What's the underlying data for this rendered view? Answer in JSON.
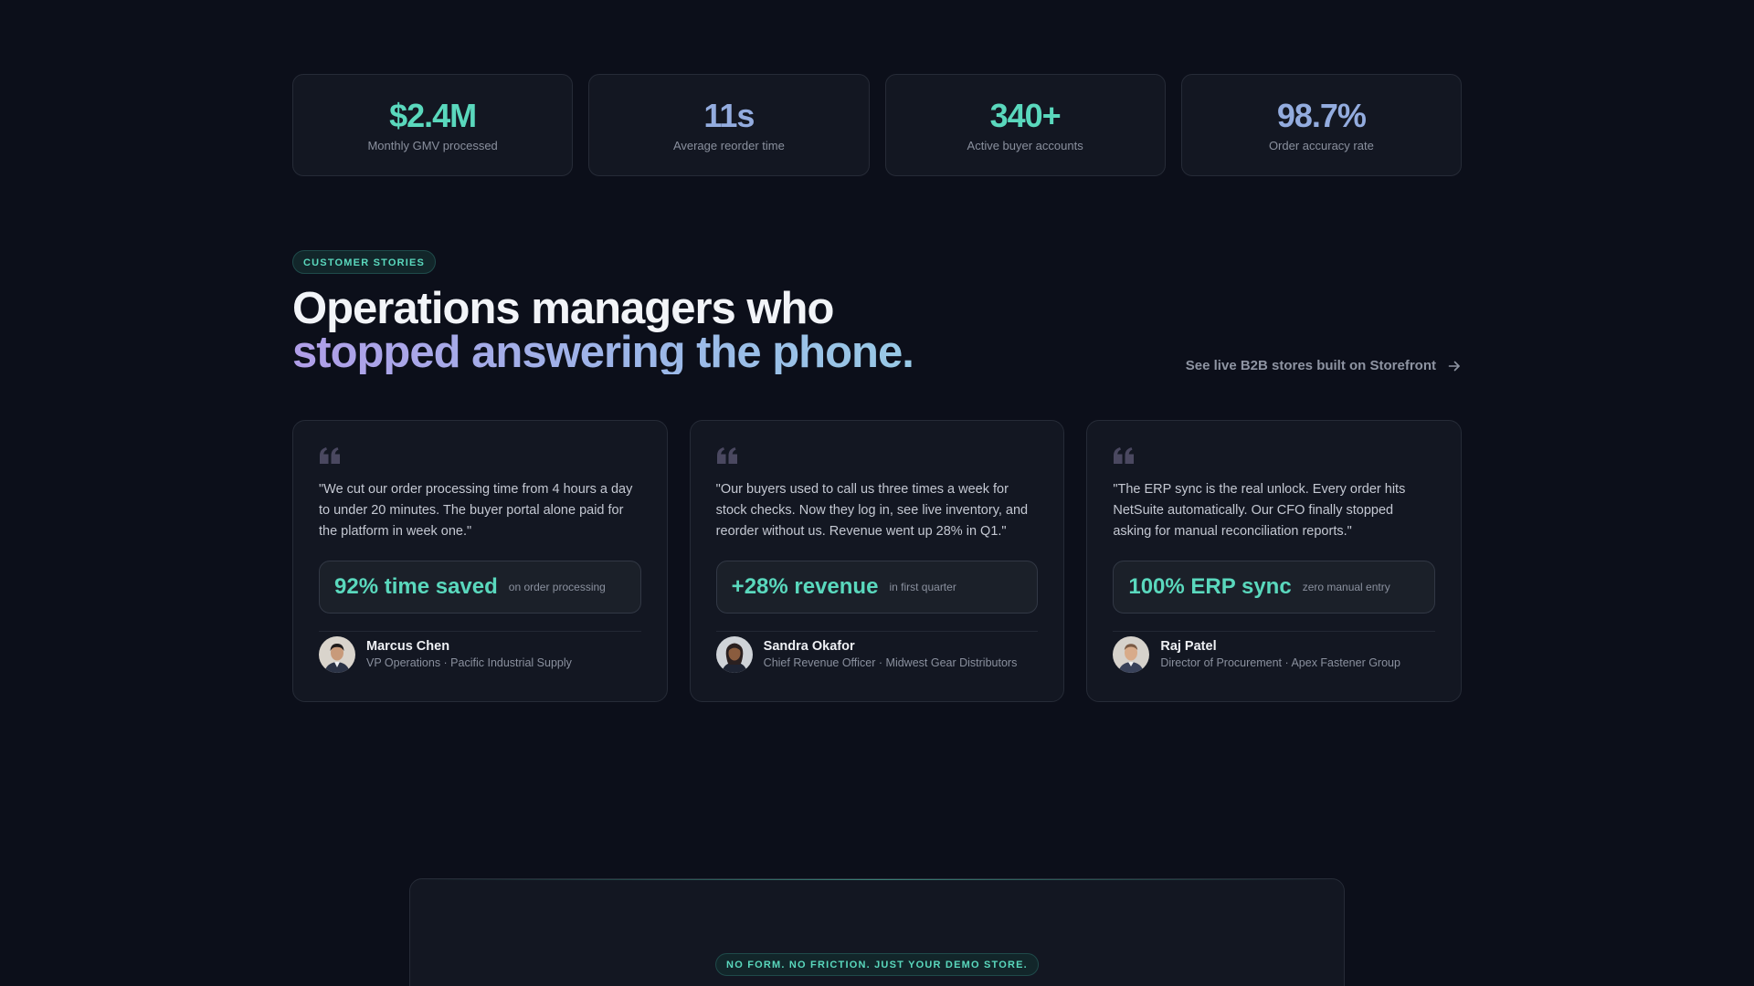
{
  "stats": [
    {
      "value": "$2.4M",
      "label": "Monthly GMV processed",
      "color": "#5ad8bd"
    },
    {
      "value": "11s",
      "label": "Average reorder time",
      "color": "#93acdf"
    },
    {
      "value": "340+",
      "label": "Active buyer accounts",
      "color": "#5ad8bd"
    },
    {
      "value": "98.7%",
      "label": "Order accuracy rate",
      "color": "#93acdf"
    }
  ],
  "section": {
    "badge": "CUSTOMER STORIES",
    "heading_line1": "Operations managers who",
    "heading_line2": "stopped answering the phone.",
    "link_label": "See live B2B stores built on Storefront",
    "link_icon": "arrow-right-icon"
  },
  "testimonials": [
    {
      "quote": "\"We cut our order processing time from 4 hours a day to under 20 minutes. The buyer portal alone paid for the platform in week one.\"",
      "metric_value": "92% time saved",
      "metric_note": "on order processing",
      "name": "Marcus Chen",
      "role": "VP Operations · Pacific Industrial Supply"
    },
    {
      "quote": "\"Our buyers used to call us three times a week for stock checks. Now they log in, see live inventory, and reorder without us. Revenue went up 28% in Q1.\"",
      "metric_value": "+28% revenue",
      "metric_note": "in first quarter",
      "name": "Sandra Okafor",
      "role": "Chief Revenue Officer · Midwest Gear Distributors"
    },
    {
      "quote": "\"The ERP sync is the real unlock. Every order hits NetSuite automatically. Our CFO finally stopped asking for manual reconciliation reports.\"",
      "metric_value": "100% ERP sync",
      "metric_note": "zero manual entry",
      "name": "Raj Patel",
      "role": "Director of Procurement · Apex Fastener Group"
    }
  ],
  "cta": {
    "badge": "NO FORM. NO FRICTION. JUST YOUR DEMO STORE."
  },
  "colors": {
    "background": "#0c0f1a",
    "card": "#131722",
    "accent_teal": "#5ad8bd",
    "accent_blue": "#93acdf"
  }
}
